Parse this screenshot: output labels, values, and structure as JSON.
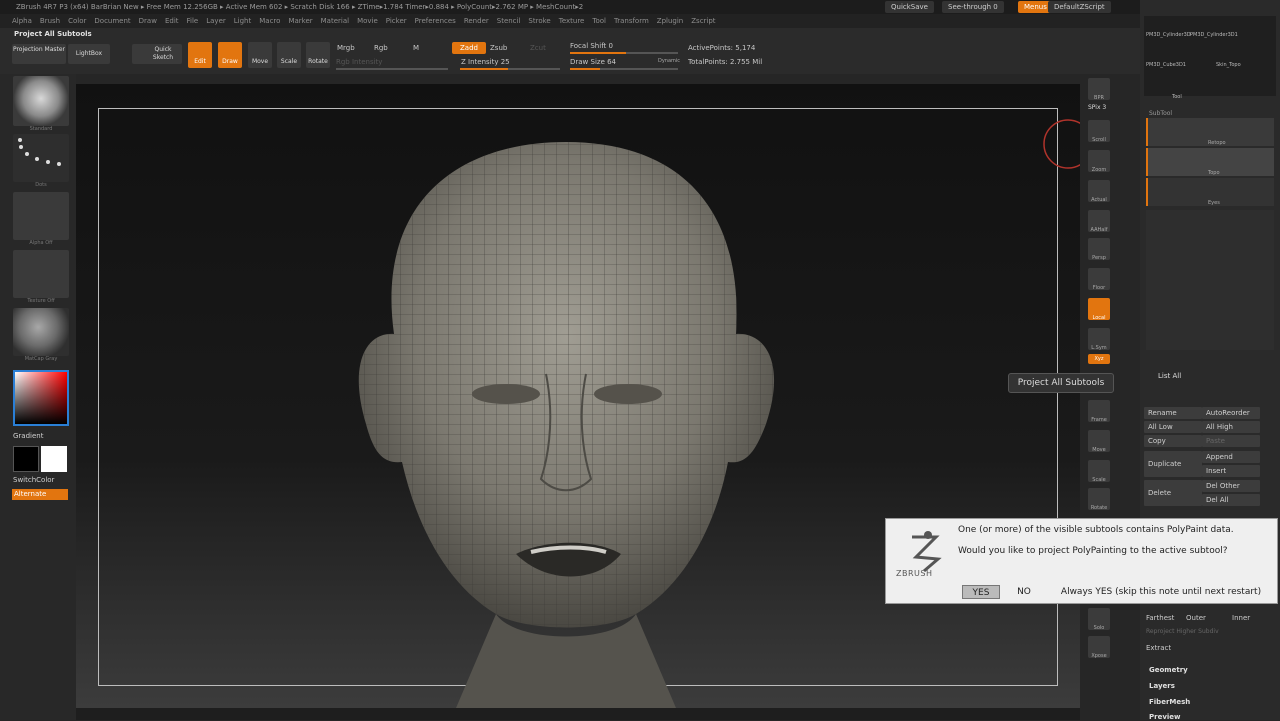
{
  "title_bar": {
    "text": "ZBrush 4R7 P3 (x64)   BarBrian New   ▸ Free Mem 12.256GB ▸ Active Mem 602 ▸ Scratch Disk 166 ▸ ZTime▸1.784 Timer▸0.884 ▸ PolyCount▸2.762 MP ▸ MeshCount▸2",
    "quicksave": "QuickSave",
    "see_through": "See-through  0",
    "menus": "Menus",
    "default_zscript": "DefaultZScript"
  },
  "menubar": [
    "Alpha",
    "Brush",
    "Color",
    "Document",
    "Draw",
    "Edit",
    "File",
    "Layer",
    "Light",
    "Macro",
    "Marker",
    "Material",
    "Movie",
    "Picker",
    "Preferences",
    "Render",
    "Stencil",
    "Stroke",
    "Texture",
    "Tool",
    "Transform",
    "Zplugin",
    "Zscript"
  ],
  "toolbar": {
    "panel_title": "Project All Subtools",
    "projection_master": "Projection Master",
    "lightbox": "LightBox",
    "quick_sketch": "Quick Sketch",
    "edit": "Edit",
    "draw": "Draw",
    "move": "Move",
    "scale": "Scale",
    "rotate": "Rotate",
    "mrgb": "Mrgb",
    "rgb": "Rgb",
    "m": "M",
    "rgb_intensity": "Rgb Intensity",
    "zadd": "Zadd",
    "zsub": "Zsub",
    "zcut": "Zcut",
    "z_intensity": "Z Intensity 25",
    "focal_shift": "Focal Shift 0",
    "draw_size": "Draw Size 64",
    "dynamic": "Dynamic",
    "active_points": "ActivePoints: 5,174",
    "total_points": "TotalPoints: 2.755 Mil"
  },
  "left_panel": {
    "standard": "Standard",
    "dots": "Dots",
    "alpha_off": "Alpha Off",
    "texture_off": "Texture Off",
    "matcap": "MatCap Gray",
    "gradient": "Gradient",
    "switch_color": "SwitchColor",
    "alternate": "Alternate"
  },
  "right_dock": {
    "spix": "SPix 3",
    "items": [
      "BPR",
      "Scroll",
      "Zoom",
      "Actual",
      "AAHalf",
      "Persp",
      "Floor",
      "Local",
      "L.Sym",
      "Xyz",
      "Frame",
      "Move",
      "Scale",
      "Rotate",
      "Solo",
      "Xpose"
    ]
  },
  "tray": {
    "top_tools": [
      "PM3D_Cylinder3D",
      "PM3D_Cylinder3D1",
      "PM3D_Cube3D1",
      "Skin_Topo",
      "Tool"
    ],
    "subtool_header": "SubTool",
    "subtools": [
      "Retopo",
      "Topo",
      "Eyes"
    ],
    "list_all": "List All",
    "rename": "Rename",
    "auto_reorder": "AutoReorder",
    "all_low": "All Low",
    "all_high": "All High",
    "copy": "Copy",
    "paste": "Paste",
    "append": "Append",
    "duplicate": "Duplicate",
    "insert": "Insert",
    "del_other": "Del Other",
    "delete": "Delete",
    "del_all": "Del All",
    "farthest": "Farthest",
    "outer": "Outer",
    "inner": "Inner",
    "reproject": "Reproject Higher Subdiv",
    "extract": "Extract",
    "geometry": "Geometry",
    "layers": "Layers",
    "fibermesh": "FiberMesh",
    "preview": "Preview"
  },
  "tooltip": "Project All Subtools",
  "dialog": {
    "line1": "One (or more) of the visible subtools contains PolyPaint data.",
    "line2": "Would you like to project PolyPainting to the active subtool?",
    "logo": "ZBRUSH",
    "yes": "YES",
    "no": "NO",
    "always_yes": "Always YES (skip this note until next restart)"
  },
  "colors": {
    "accent": "#e2750f",
    "viewport_bg": "#1a1a1a"
  }
}
